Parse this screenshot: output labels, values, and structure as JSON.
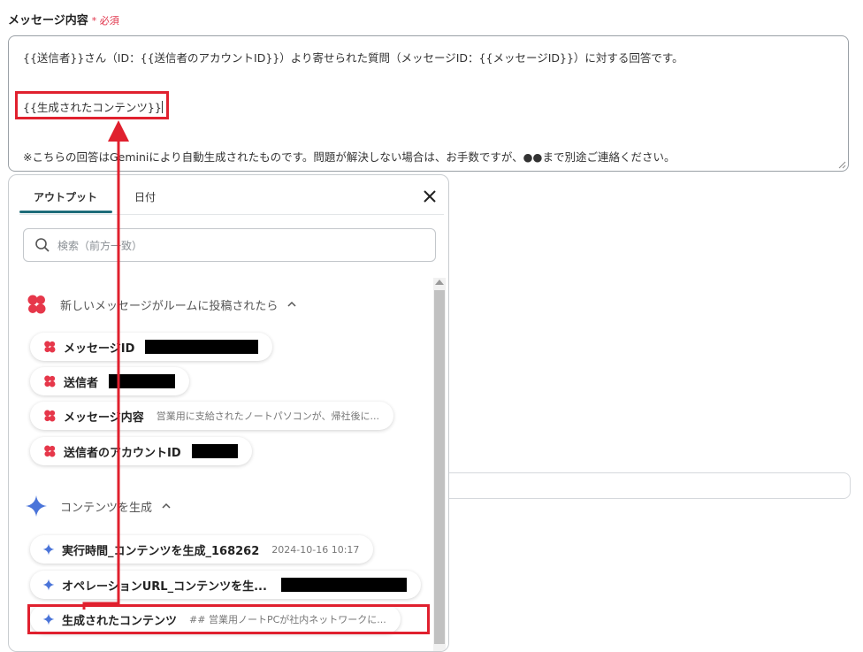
{
  "field": {
    "label": "メッセージ内容",
    "required_mark": "*",
    "required_text": "必須",
    "lines": [
      "{{送信者}}さん（ID：{{送信者のアカウントID}}）より寄せられた質問（メッセージID：{{メッセージID}}）に対する回答です。",
      "{{生成されたコンテンツ}}",
      "※こちらの回答はGeminiにより自動生成されたものです。問題が解決しない場合は、お手数ですが、●●まで別途ご連絡ください。"
    ]
  },
  "panel": {
    "tabs": [
      {
        "label": "アウトプット",
        "active": true
      },
      {
        "label": "日付",
        "active": false
      }
    ],
    "search_placeholder": "検索（前方一致）",
    "sections": [
      {
        "title": "新しいメッセージがルームに投稿されたら",
        "icon": "chatwork-logo-icon",
        "items": [
          {
            "name": "メッセージID",
            "value": "",
            "redacted": true
          },
          {
            "name": "送信者",
            "value": "",
            "redacted": true
          },
          {
            "name": "メッセージ内容",
            "value": "営業用に支給されたノートパソコンが、帰社後に...",
            "redacted": false
          },
          {
            "name": "送信者のアカウントID",
            "value": "",
            "redacted": true
          }
        ]
      },
      {
        "title": "コンテンツを生成",
        "icon": "gemini-sparkle-icon",
        "items": [
          {
            "name": "実行時間_コンテンツを生成_168262",
            "value": "2024-10-16 10:17",
            "redacted": false
          },
          {
            "name": "オペレーションURL_コンテンツを生...",
            "value": "",
            "redacted": true
          },
          {
            "name": "生成されたコンテンツ",
            "value": "## 営業用ノートPCが社内ネットワークに...",
            "redacted": false
          }
        ]
      }
    ]
  },
  "colors": {
    "highlight": "#e0202e",
    "tab_underline": "#1f6d7a",
    "required": "#e0334a",
    "gemini_blue": "#4a74d9"
  }
}
